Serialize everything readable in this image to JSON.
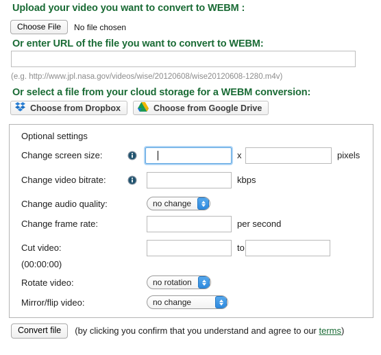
{
  "upload": {
    "heading": "Upload your video you want to convert to WEBM :",
    "choose_file_label": "Choose File",
    "no_file_text": "No file chosen"
  },
  "url": {
    "heading": "Or enter URL of the file you want to convert to WEBM:",
    "value": "",
    "placeholder": "",
    "hint": "(e.g. http://www.jpl.nasa.gov/videos/wise/20120608/wise20120608-1280.m4v)"
  },
  "cloud": {
    "heading": "Or select a file from your cloud storage for a WEBM conversion:",
    "dropbox_label": "Choose from Dropbox",
    "dropbox_icon": "dropbox-icon",
    "gdrive_label": "Choose from Google Drive",
    "gdrive_icon": "google-drive-icon"
  },
  "settings": {
    "title": "Optional settings",
    "screen_size": {
      "label": "Change screen size:",
      "info_icon": "info-icon",
      "width_value": "",
      "height_value": "",
      "separator": "x",
      "unit": "pixels"
    },
    "video_bitrate": {
      "label": "Change video bitrate:",
      "info_icon": "info-icon",
      "value": "",
      "unit": "kbps"
    },
    "audio_quality": {
      "label": "Change audio quality:",
      "selected": "no change"
    },
    "frame_rate": {
      "label": "Change frame rate:",
      "value": "",
      "unit": "per second"
    },
    "cut_video": {
      "label": "Cut video:",
      "from_value": "",
      "to_label": "to",
      "to_value": "",
      "format_note": "(00:00:00)"
    },
    "rotate": {
      "label": "Rotate video:",
      "selected": "no rotation"
    },
    "mirror": {
      "label": "Mirror/flip video:",
      "selected": "no change"
    }
  },
  "footer": {
    "convert_label": "Convert file",
    "text_before": "(by clicking you confirm that you understand and agree to our ",
    "terms_label": "terms",
    "text_after": ")"
  },
  "colors": {
    "heading_green": "#1a6b35",
    "link_green": "#1a6b35",
    "focus_blue": "#5ba4e0",
    "stepper_blue": "#2f8ade"
  }
}
